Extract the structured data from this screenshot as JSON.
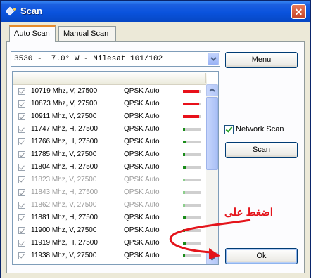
{
  "window": {
    "title": "Scan",
    "close_label": "✕"
  },
  "tabs": [
    {
      "label": "Auto Scan",
      "active": true
    },
    {
      "label": "Manual Scan",
      "active": false
    }
  ],
  "satellite_select": {
    "value": "3530 -  7.0° W - Nilesat 101/102"
  },
  "buttons": {
    "menu": "Menu",
    "scan": "Scan",
    "ok": "Ok"
  },
  "network_scan": {
    "label": "Network Scan",
    "checked": true
  },
  "annotation": {
    "text": "اضغط على"
  },
  "transponders": [
    {
      "freq": "10719 Mhz, V, 27500",
      "mod": "QPSK Auto",
      "checked": true,
      "enabled": true,
      "signal": 0.9,
      "color": "#e8111a"
    },
    {
      "freq": "10873 Mhz, V, 27500",
      "mod": "QPSK Auto",
      "checked": true,
      "enabled": true,
      "signal": 0.9,
      "color": "#e8111a"
    },
    {
      "freq": "10911 Mhz, V, 27500",
      "mod": "QPSK Auto",
      "checked": true,
      "enabled": true,
      "signal": 0.9,
      "color": "#e8111a"
    },
    {
      "freq": "11747 Mhz, H, 27500",
      "mod": "QPSK Auto",
      "checked": true,
      "enabled": true,
      "signal": 0.12,
      "color": "#1a8c1a"
    },
    {
      "freq": "11766 Mhz, H, 27500",
      "mod": "QPSK Auto",
      "checked": true,
      "enabled": true,
      "signal": 0.15,
      "color": "#1a8c1a"
    },
    {
      "freq": "11785 Mhz, V, 27500",
      "mod": "QPSK Auto",
      "checked": true,
      "enabled": true,
      "signal": 0.12,
      "color": "#1a8c1a"
    },
    {
      "freq": "11804 Mhz, H, 27500",
      "mod": "QPSK Auto",
      "checked": true,
      "enabled": true,
      "signal": 0.15,
      "color": "#1a8c1a"
    },
    {
      "freq": "11823 Mhz, V, 27500",
      "mod": "QPSK Auto",
      "checked": true,
      "enabled": false,
      "signal": 0.12,
      "color": "#8ccf8c"
    },
    {
      "freq": "11843 Mhz, H, 27500",
      "mod": "QPSK Auto",
      "checked": true,
      "enabled": false,
      "signal": 0.12,
      "color": "#8ccf8c"
    },
    {
      "freq": "11862 Mhz, V, 27500",
      "mod": "QPSK Auto",
      "checked": true,
      "enabled": false,
      "signal": 0.12,
      "color": "#8ccf8c"
    },
    {
      "freq": "11881 Mhz, H, 27500",
      "mod": "QPSK Auto",
      "checked": true,
      "enabled": true,
      "signal": 0.15,
      "color": "#1a8c1a"
    },
    {
      "freq": "11900 Mhz, V, 27500",
      "mod": "QPSK Auto",
      "checked": true,
      "enabled": true,
      "signal": 0.12,
      "color": "#1a8c1a"
    },
    {
      "freq": "11919 Mhz, H, 27500",
      "mod": "QPSK Auto",
      "checked": true,
      "enabled": true,
      "signal": 0.15,
      "color": "#1a8c1a"
    },
    {
      "freq": "11938 Mhz, V, 27500",
      "mod": "QPSK Auto",
      "checked": true,
      "enabled": true,
      "signal": 0.12,
      "color": "#1a8c1a"
    }
  ]
}
